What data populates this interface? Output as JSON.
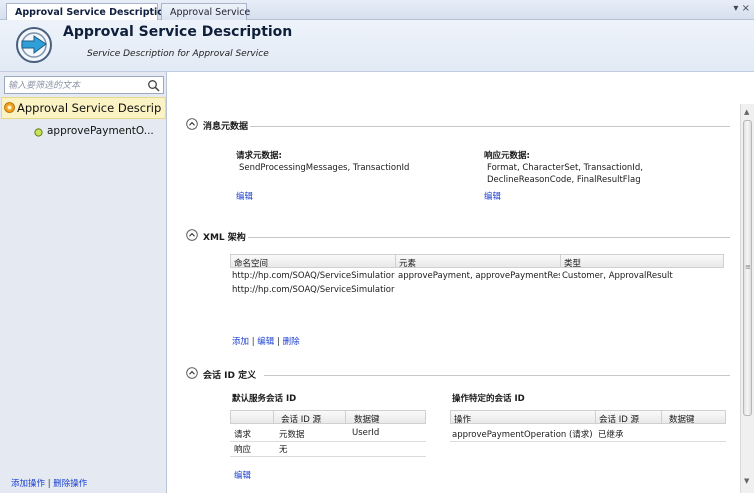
{
  "tabs": [
    {
      "label": "Approval Service Description",
      "active": true
    },
    {
      "label": "Approval Service",
      "active": false
    }
  ],
  "tab_menu_glyph": "▾ ×",
  "header": {
    "title": "Approval Service Description",
    "subtitle": "Service Description for Approval Service"
  },
  "left": {
    "filter_placeholder": "输入要筛选的文本",
    "tree_root": "Approval Service Descrip",
    "tree_child": "approvePaymentO...",
    "actions": {
      "add": "添加操作",
      "separator": "|",
      "delete": "删除操作"
    }
  },
  "metadata": {
    "title": "消息元数据",
    "request_label": "请求元数据:",
    "request_value": "SendProcessingMessages, TransactionId",
    "request_edit": "编辑",
    "response_label": "响应元数据:",
    "response_value_1": "Format, CharacterSet, TransactionId,",
    "response_value_2": "DeclineReasonCode, FinalResultFlag",
    "response_edit": "编辑"
  },
  "xml": {
    "title": "XML 架构",
    "columns": {
      "namespace": "命名空间",
      "element": "元素",
      "type": "类型"
    },
    "rows": [
      {
        "namespace": "http://hp.com/SOAQ/ServiceSimulatior",
        "element": "approvePayment, approvePaymentRes",
        "type": "Customer, ApprovalResult"
      },
      {
        "namespace": "http://hp.com/SOAQ/ServiceSimulatior",
        "element": "",
        "type": ""
      }
    ],
    "actions": {
      "add": "添加",
      "separator": "|",
      "edit": "编辑",
      "delete": "删除"
    }
  },
  "session": {
    "title": "会话 ID 定义",
    "default_label": "默认服务会话 ID",
    "default_columns": {
      "source": "会话 ID 源",
      "key": "数据键"
    },
    "default_rows": [
      {
        "name": "请求",
        "source": "元数据",
        "key": "UserId"
      },
      {
        "name": "响应",
        "source": "无",
        "key": ""
      }
    ],
    "default_edit": "编辑",
    "op_label": "操作特定的会话 ID",
    "op_columns": {
      "operation": "操作",
      "source": "会话 ID 源",
      "key": "数据键"
    },
    "op_rows": [
      {
        "operation": "approvePaymentOperation (请求)",
        "source": "已继承",
        "key": ""
      }
    ]
  },
  "colors": {
    "link": "#1a3fd0",
    "tree_selected": "#fbf3c4",
    "left_panel": "#e4e9f2"
  }
}
